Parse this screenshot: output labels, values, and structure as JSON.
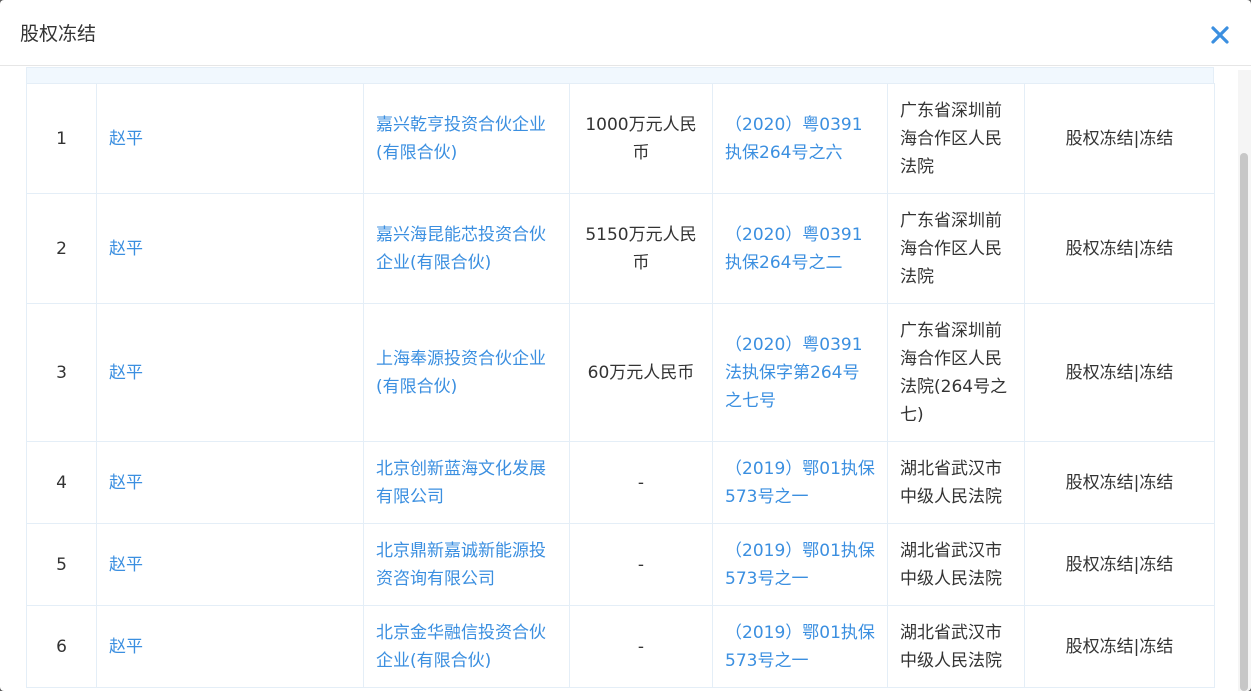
{
  "dialog": {
    "title": "股权冻结",
    "close_icon": "close-icon",
    "accent_color": "#3b8fe0"
  },
  "rows": [
    {
      "index": "1",
      "person": "赵平",
      "company": "嘉兴乾亨投资合伙企业(有限合伙)",
      "amount": "1000万元人民币",
      "case_no": "（2020）粤0391执保264号之六",
      "court": "广东省深圳前海合作区人民法院",
      "status": "股权冻结|冻结"
    },
    {
      "index": "2",
      "person": "赵平",
      "company": "嘉兴海昆能芯投资合伙企业(有限合伙)",
      "amount": "5150万元人民币",
      "case_no": "（2020）粤0391执保264号之二",
      "court": "广东省深圳前海合作区人民法院",
      "status": "股权冻结|冻结"
    },
    {
      "index": "3",
      "person": "赵平",
      "company": "上海奉源投资合伙企业(有限合伙)",
      "amount": "60万元人民币",
      "case_no": "（2020）粤0391法执保字第264号之七号",
      "court": "广东省深圳前海合作区人民法院(264号之七)",
      "status": "股权冻结|冻结"
    },
    {
      "index": "4",
      "person": "赵平",
      "company": "北京创新蓝海文化发展有限公司",
      "amount": "-",
      "case_no": "（2019）鄂01执保573号之一",
      "court": "湖北省武汉市中级人民法院",
      "status": "股权冻结|冻结"
    },
    {
      "index": "5",
      "person": "赵平",
      "company": "北京鼎新嘉诚新能源投资咨询有限公司",
      "amount": "-",
      "case_no": "（2019）鄂01执保573号之一",
      "court": "湖北省武汉市中级人民法院",
      "status": "股权冻结|冻结"
    },
    {
      "index": "6",
      "person": "赵平",
      "company": "北京金华融信投资合伙企业(有限合伙)",
      "amount": "-",
      "case_no": "（2019）鄂01执保573号之一",
      "court": "湖北省武汉市中级人民法院",
      "status": "股权冻结|冻结"
    }
  ]
}
